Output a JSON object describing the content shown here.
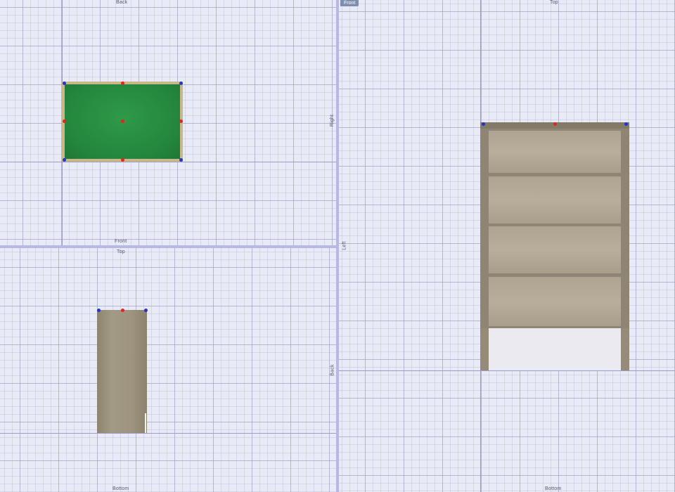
{
  "viewports": {
    "top": {
      "label_top": "Back",
      "label_bottom": "Front",
      "label_right": "Right"
    },
    "front": {
      "label_top": "Top",
      "label_bottom": "Bottom"
    },
    "side": {
      "tag": "Front",
      "label_top": "Top",
      "label_bottom": "Bottom",
      "label_left": "Left",
      "label_back": "Back"
    }
  },
  "colors": {
    "grid_background": "#e8eaf6",
    "divider": "#b7b8e4",
    "panel_green": "#2e9a48",
    "wood": "#a39a86",
    "handle_center": "#e8221c",
    "handle_corner": "#2233d8"
  }
}
